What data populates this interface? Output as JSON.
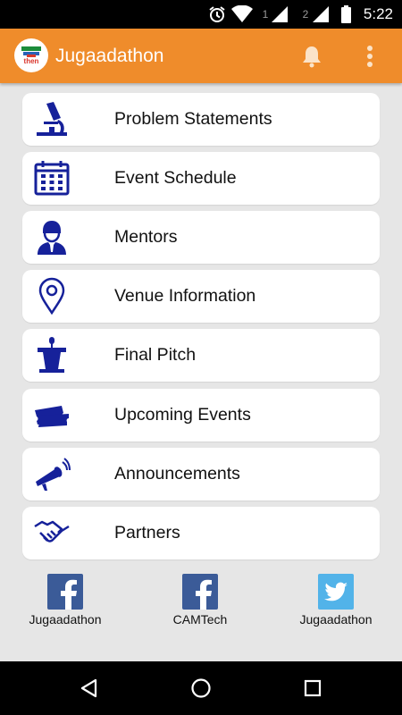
{
  "status_bar": {
    "time": "5:22",
    "sim1": "1",
    "sim2": "2",
    "icons": [
      "alarm-icon",
      "wifi-icon",
      "signal-icon",
      "signal-icon",
      "battery-icon"
    ]
  },
  "app_bar": {
    "title": "Jugaadathon",
    "logo_text": "then",
    "actions": [
      "notification-bell-icon",
      "overflow-menu-icon"
    ]
  },
  "colors": {
    "primary": "#ef8c2b",
    "icon_blue": "#16219a",
    "facebook": "#3b5b98",
    "twitter": "#52b3e9",
    "background": "#e6e6e6"
  },
  "menu": {
    "items": [
      {
        "label": "Problem Statements",
        "icon": "microscope-icon"
      },
      {
        "label": "Event Schedule",
        "icon": "calendar-icon"
      },
      {
        "label": "Mentors",
        "icon": "mentor-icon"
      },
      {
        "label": "Venue Information",
        "icon": "location-pin-icon"
      },
      {
        "label": "Final Pitch",
        "icon": "podium-icon"
      },
      {
        "label": "Upcoming Events",
        "icon": "tickets-icon"
      },
      {
        "label": "Announcements",
        "icon": "megaphone-icon"
      },
      {
        "label": "Partners",
        "icon": "handshake-icon"
      }
    ]
  },
  "social": {
    "links": [
      {
        "label": "Jugaadathon",
        "icon": "facebook-icon"
      },
      {
        "label": "CAMTech",
        "icon": "facebook-icon"
      },
      {
        "label": "Jugaadathon",
        "icon": "twitter-icon"
      }
    ]
  },
  "nav_bar": {
    "buttons": [
      "back-icon",
      "home-icon",
      "recents-icon"
    ]
  }
}
